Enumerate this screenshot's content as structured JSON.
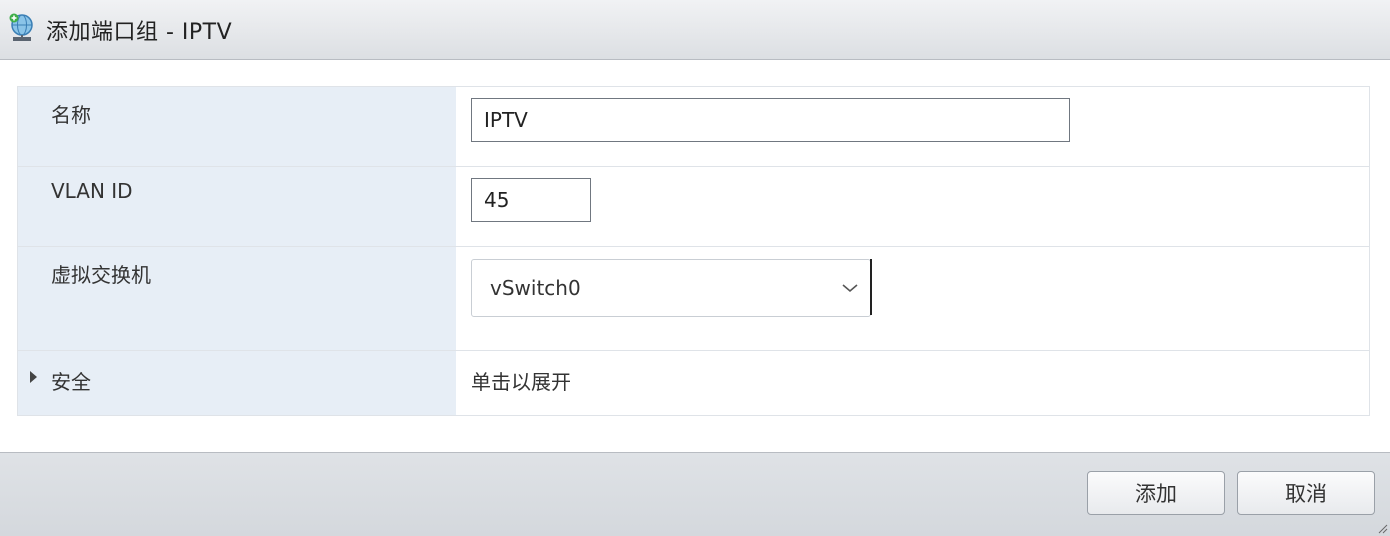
{
  "dialog": {
    "title": "添加端口组 - IPTV",
    "icon": "network-portgroup-icon"
  },
  "form": {
    "name": {
      "label": "名称",
      "value": "IPTV"
    },
    "vlan": {
      "label": "VLAN ID",
      "value": "45"
    },
    "vswitch": {
      "label": "虚拟交换机",
      "value": "vSwitch0",
      "icon": "chevron-down-icon"
    },
    "security": {
      "label": "安全",
      "hint": "单击以展开",
      "icon": "expand-arrow-icon"
    }
  },
  "footer": {
    "add_label": "添加",
    "cancel_label": "取消"
  },
  "colors": {
    "label_bg": "#e7eef6",
    "titlebar_bg": "#dcdfe3",
    "footer_bg": "#d4d8dd"
  }
}
